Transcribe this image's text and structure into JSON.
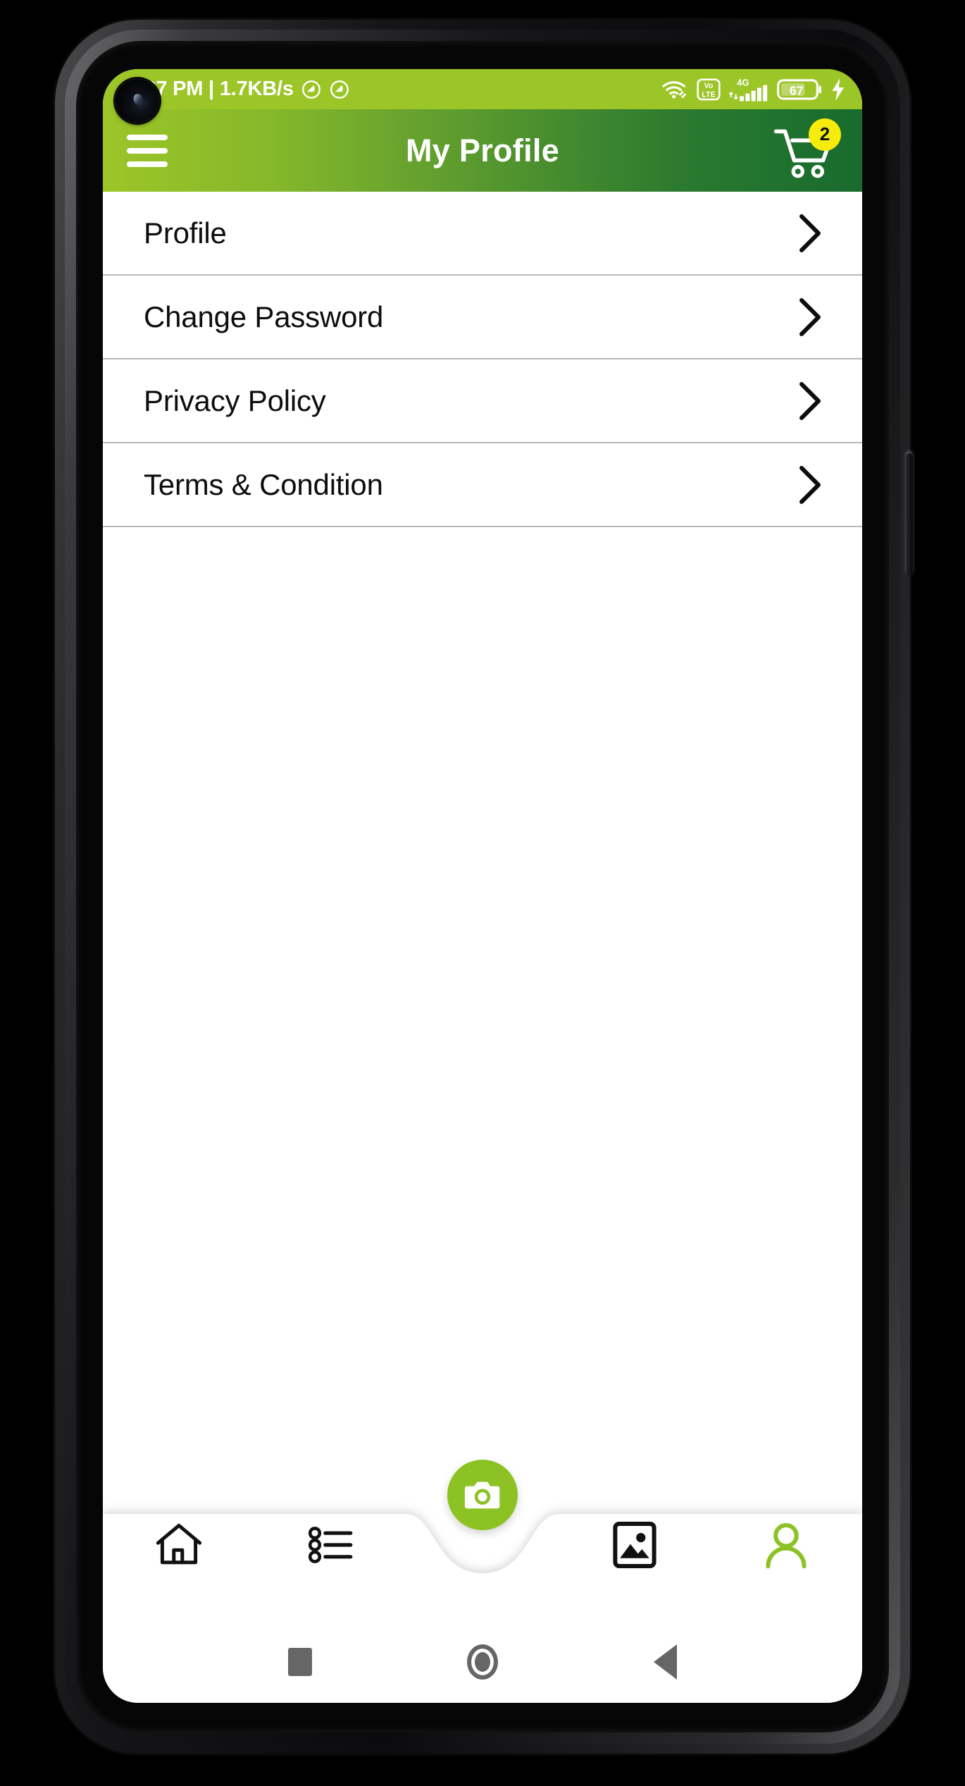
{
  "status_bar": {
    "time_and_speed": "7:27 PM | 1.7KB/s",
    "dnd_icon_1": "do-not-disturb-icon",
    "dnd_icon_2": "do-not-disturb-icon",
    "wifi_icon": "wifi-icon",
    "volte_top": "Vo",
    "volte_bottom": "LTE",
    "network_type": "4G",
    "signal_icon": "signal-bars-icon",
    "battery_level": "67",
    "charging_icon": "charging-bolt-icon",
    "background_color": "#9cc527"
  },
  "app_bar": {
    "menu_icon": "hamburger-menu-icon",
    "title": "My Profile",
    "cart_icon": "shopping-cart-icon",
    "cart_badge_count": "2",
    "gradient_start": "#9cc527",
    "gradient_end": "#176b2d",
    "badge_color": "#f5ec0b"
  },
  "menu": {
    "items": [
      {
        "label": "Profile",
        "chevron": "chevron-right-icon"
      },
      {
        "label": "Change Password",
        "chevron": "chevron-right-icon"
      },
      {
        "label": "Privacy Policy",
        "chevron": "chevron-right-icon"
      },
      {
        "label": "Terms & Condition",
        "chevron": "chevron-right-icon"
      }
    ]
  },
  "bottom_nav": {
    "items": [
      {
        "icon": "home-icon",
        "active": false
      },
      {
        "icon": "list-icon",
        "active": false
      },
      {
        "icon": "gallery-image-icon",
        "active": false
      },
      {
        "icon": "person-profile-icon",
        "active": true
      }
    ],
    "fab_icon": "camera-icon",
    "fab_color": "#8cc224",
    "active_color": "#8cc224",
    "inactive_color": "#111111"
  },
  "android_nav": {
    "recents_icon": "square-recents-icon",
    "home_icon": "circle-home-icon",
    "back_icon": "triangle-back-icon",
    "color": "#666666"
  },
  "device": {
    "camera_icon": "punch-hole-camera",
    "side_button": "power-button"
  }
}
